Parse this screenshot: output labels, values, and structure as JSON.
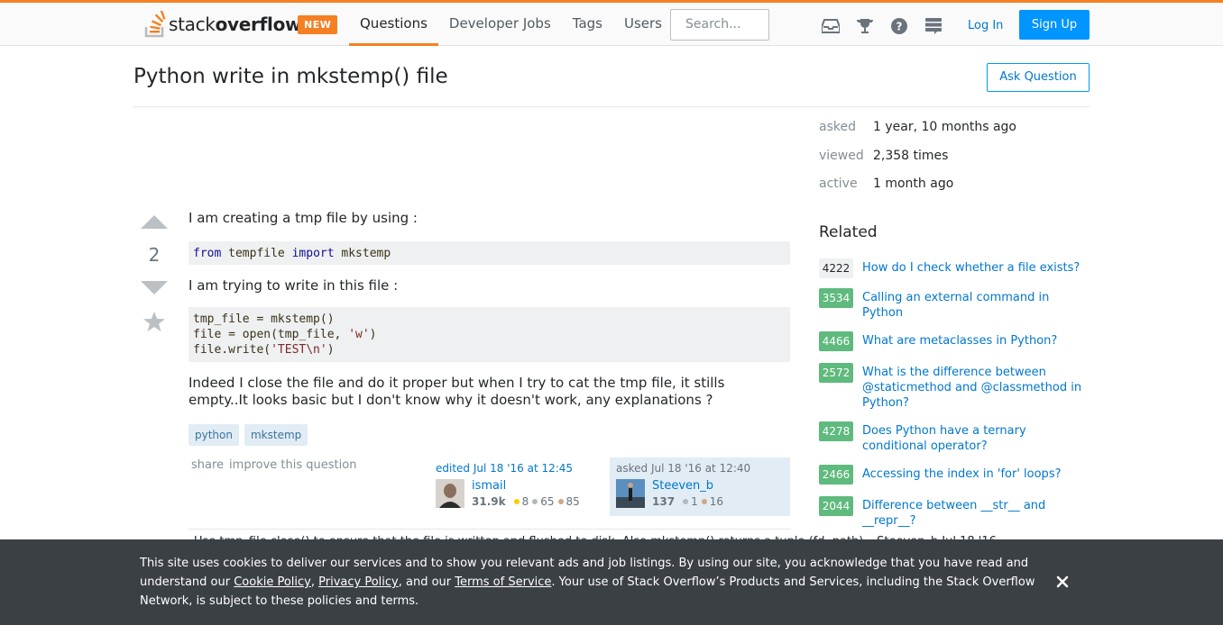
{
  "header": {
    "logo_text_light": "stack",
    "logo_text_bold": "overflow",
    "new_badge": "NEW",
    "nav": [
      "Questions",
      "Developer Jobs",
      "Tags",
      "Users"
    ],
    "search_placeholder": "Search...",
    "login": "Log In",
    "signup": "Sign Up",
    "icons": [
      "inbox-icon",
      "trophy-icon",
      "help-icon",
      "stackexchange-icon"
    ]
  },
  "question": {
    "title": "Python write in mkstemp() file",
    "ask_button": "Ask Question",
    "votes": "2",
    "p1": "I am creating a tmp file by using :",
    "code1": {
      "kw1": "from",
      "mid": " tempfile ",
      "kw2": "import",
      "end": " mkstemp"
    },
    "p2": "I am trying to write in this file :",
    "code2": {
      "line1": "tmp_file = mkstemp()",
      "line2a": "file = open(tmp_file, ",
      "line2s": "'w'",
      "line2b": ")",
      "line3a": "file.write(",
      "line3s": "'TEST\\n'",
      "line3b": ")"
    },
    "p3_line1": "Indeed I close the file and do it proper but when I try to cat the tmp file, it stills",
    "p3_line2": "empty..It looks basic but I don't know why it doesn't work, any explanations ?",
    "tags": [
      "python",
      "mkstemp"
    ],
    "menu": [
      "share",
      "improve this question"
    ],
    "edited": {
      "action": "edited Jul 18 '16 at 12:45",
      "name": "ismail",
      "rep": "31.9k",
      "gold": "8",
      "silver": "65",
      "bronze": "85"
    },
    "asked": {
      "action": "asked Jul 18 '16 at 12:40",
      "name": "Steeven_b",
      "rep": "137",
      "silver": "1",
      "bronze": "16"
    },
    "comment_peek": "Use tmp_file.close() to ensure that the file is written and flushed to disk. Also mkstemp() returns a tuple (fd, path) –  Steeven_b  Jul 18 '16"
  },
  "sidebar": {
    "stats": [
      {
        "label": "asked",
        "value": "1 year, 10 months ago"
      },
      {
        "label": "viewed",
        "value": "2,358 times"
      },
      {
        "label": "active",
        "value": "1 month ago"
      }
    ],
    "related_heading": "Related",
    "related": [
      {
        "score": "4222",
        "title": "How do I check whether a file exists?",
        "accepted": false
      },
      {
        "score": "3534",
        "title": "Calling an external command in Python",
        "accepted": true
      },
      {
        "score": "4466",
        "title": "What are metaclasses in Python?",
        "accepted": true
      },
      {
        "score": "2572",
        "title": "What is the difference between @staticmethod and @classmethod in Python?",
        "accepted": true
      },
      {
        "score": "4278",
        "title": "Does Python have a ternary conditional operator?",
        "accepted": true
      },
      {
        "score": "2466",
        "title": "Accessing the index in 'for' loops?",
        "accepted": true
      },
      {
        "score": "2044",
        "title": "Difference between __str__ and __repr__?",
        "accepted": true
      }
    ]
  },
  "cookie": {
    "t1": "This site uses cookies to deliver our services and to show you relevant ads and job listings. By using our site, you acknowledge that you have read and understand our ",
    "cookie_policy": "Cookie Policy",
    "sep1": ", ",
    "privacy_policy": "Privacy Policy",
    "sep2": ", and our ",
    "terms": "Terms of Service",
    "t2": ". Your use of Stack Overflow’s Products and Services, including the Stack Overflow Network, is subject to these policies and terms."
  },
  "colors": {
    "accent": "#f48024",
    "link": "#0077cc",
    "accepted": "#5fba7d"
  }
}
